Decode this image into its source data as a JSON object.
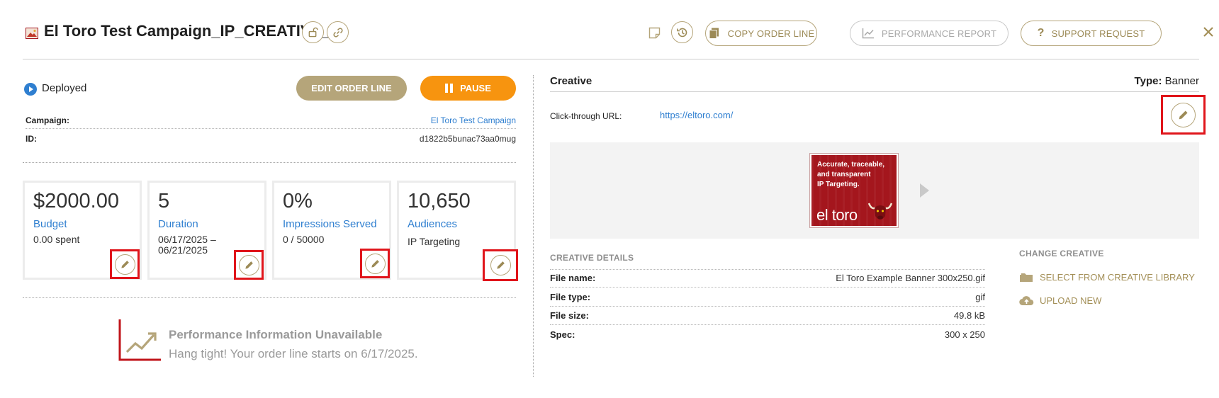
{
  "header": {
    "title": "El Toro Test Campaign_IP_CREATIVE_...",
    "buttons": {
      "copy_order_line": "COPY ORDER LINE",
      "performance_report": "PERFORMANCE REPORT",
      "support_request": "SUPPORT REQUEST"
    }
  },
  "status": {
    "label": "Deployed",
    "edit_order_line": "EDIT ORDER LINE",
    "pause": "PAUSE"
  },
  "details": {
    "campaign_label": "Campaign:",
    "campaign_value": "El Toro Test Campaign",
    "id_label": "ID:",
    "id_value": "d1822b5bunac73aa0mug"
  },
  "cards": {
    "budget": {
      "value": "$2000.00",
      "label": "Budget",
      "sub": "0.00 spent"
    },
    "duration": {
      "value": "5",
      "label": "Duration",
      "sub_line1": "06/17/2025 –",
      "sub_line2": "06/21/2025"
    },
    "impressions": {
      "value": "0%",
      "label": "Impressions Served",
      "sub": "0 / 50000"
    },
    "audiences": {
      "value": "10,650",
      "label": "Audiences",
      "sub": "IP Targeting"
    }
  },
  "performance": {
    "title": "Performance Information Unavailable",
    "message": "Hang tight! Your order line starts on 6/17/2025."
  },
  "creative": {
    "heading": "Creative",
    "type_label": "Type:",
    "type_value": "Banner",
    "click_through_label": "Click-through URL:",
    "click_through_url": "https://eltoro.com/",
    "banner": {
      "line1": "Accurate, traceable,",
      "line2": "and transparent",
      "line3": "IP Targeting.",
      "logo": "el toro"
    },
    "details_heading": "CREATIVE DETAILS",
    "details": [
      {
        "label": "File name:",
        "value": "El Toro Example Banner 300x250.gif"
      },
      {
        "label": "File type:",
        "value": "gif"
      },
      {
        "label": "File size:",
        "value": "49.8 kB"
      },
      {
        "label": "Spec:",
        "value": "300 x 250"
      }
    ],
    "change_heading": "CHANGE CREATIVE",
    "select_library": "SELECT FROM CREATIVE LIBRARY",
    "upload_new": "UPLOAD NEW"
  },
  "colors": {
    "accent_gold": "#b5a57a",
    "pause_orange": "#f7940f",
    "link_blue": "#2f7fd0",
    "highlight_red": "#e0151b"
  },
  "icons": {
    "title": "image-icon",
    "lock": "unlock-icon",
    "link": "link-icon",
    "note": "note-icon",
    "history": "history-icon",
    "copy": "copy-icon",
    "chart": "chart-line-icon",
    "help": "question-icon",
    "close": "close-icon",
    "edit": "pencil-icon",
    "folder": "folder-icon",
    "upload": "cloud-upload-icon"
  }
}
